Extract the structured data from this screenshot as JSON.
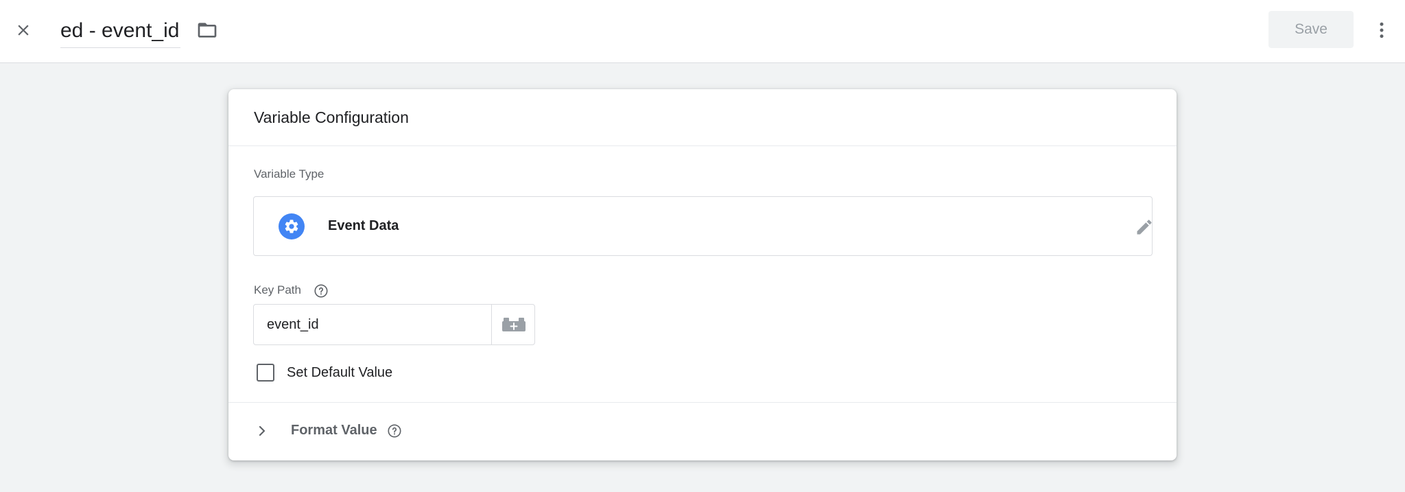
{
  "header": {
    "title": "ed - event_id",
    "save_label": "Save"
  },
  "card": {
    "title": "Variable Configuration",
    "variable_type_label": "Variable Type",
    "variable_type_name": "Event Data",
    "key_path_label": "Key Path",
    "key_path_value": "event_id",
    "default_value_label": "Set Default Value",
    "format_value_label": "Format Value"
  },
  "colors": {
    "accent": "#4285f4",
    "background": "#f1f3f4",
    "icon_gray": "#5f6368",
    "disabled_text": "#9aa0a6"
  },
  "icons": {
    "close": "close-icon",
    "folder": "folder-icon",
    "more": "more-vert-icon",
    "variable_type": "gear-icon",
    "edit": "pencil-icon",
    "help": "help-circle-icon",
    "variable_picker": "lego-brick-plus-icon",
    "chevron": "chevron-right-icon"
  }
}
